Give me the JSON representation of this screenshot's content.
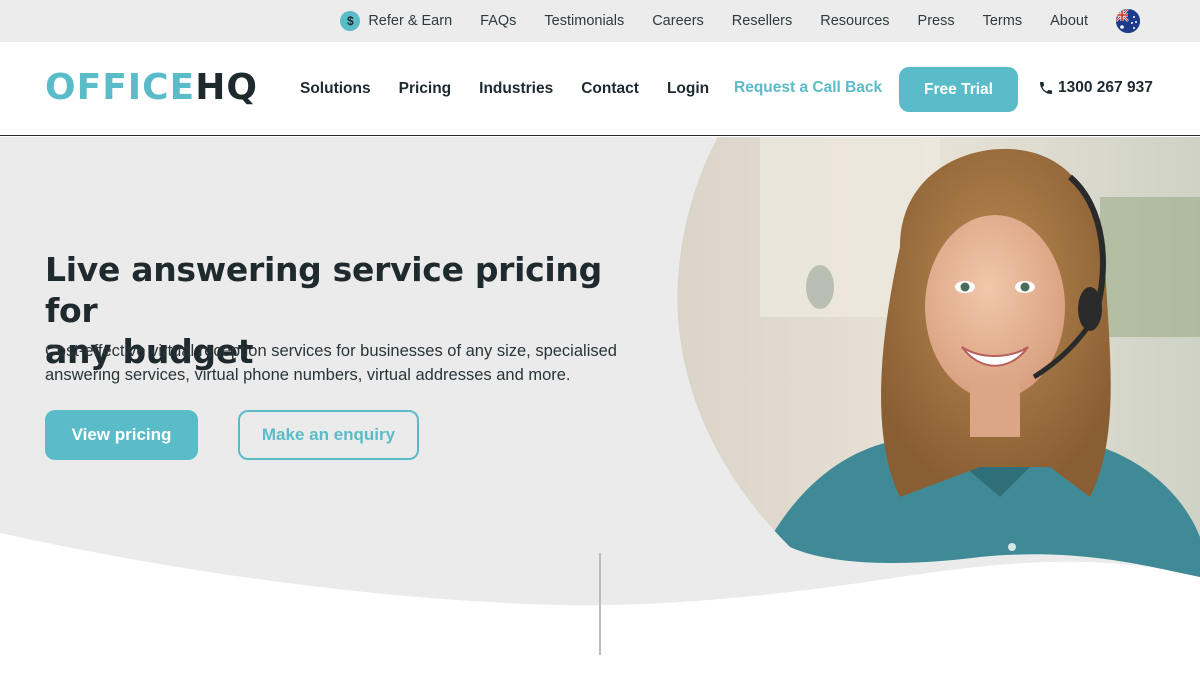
{
  "topbar": {
    "refer_label": "Refer & Earn",
    "coin_glyph": "$",
    "links": [
      "FAQs",
      "Testimonials",
      "Careers",
      "Resellers",
      "Resources",
      "Press",
      "Terms",
      "About"
    ],
    "flag_icon": "australia-flag-icon"
  },
  "nav": {
    "logo_part1": "OFFICE",
    "logo_part2": "HQ",
    "items": [
      "Solutions",
      "Pricing",
      "Industries",
      "Contact",
      "Login"
    ],
    "callback_label": "Request a Call Back",
    "trial_label": "Free Trial",
    "phone_number": "1300 267 937",
    "phone_icon": "phone-icon"
  },
  "hero": {
    "headline_line1": "Live answering service pricing for",
    "headline_line2": "any budget",
    "subtext_line1": "Cost-effective virtual reception services for businesses of any size, specialised",
    "subtext_line2": "answering services, virtual phone numbers, virtual addresses and more.",
    "primary_button": "View pricing",
    "secondary_button": "Make an enquiry",
    "image": "smiling-receptionist-with-headset-photo"
  },
  "colors": {
    "accent": "#5bbcc9",
    "dark": "#1f2a2e",
    "hero_bg": "#ebebeb",
    "topbar_bg": "#ececec"
  }
}
